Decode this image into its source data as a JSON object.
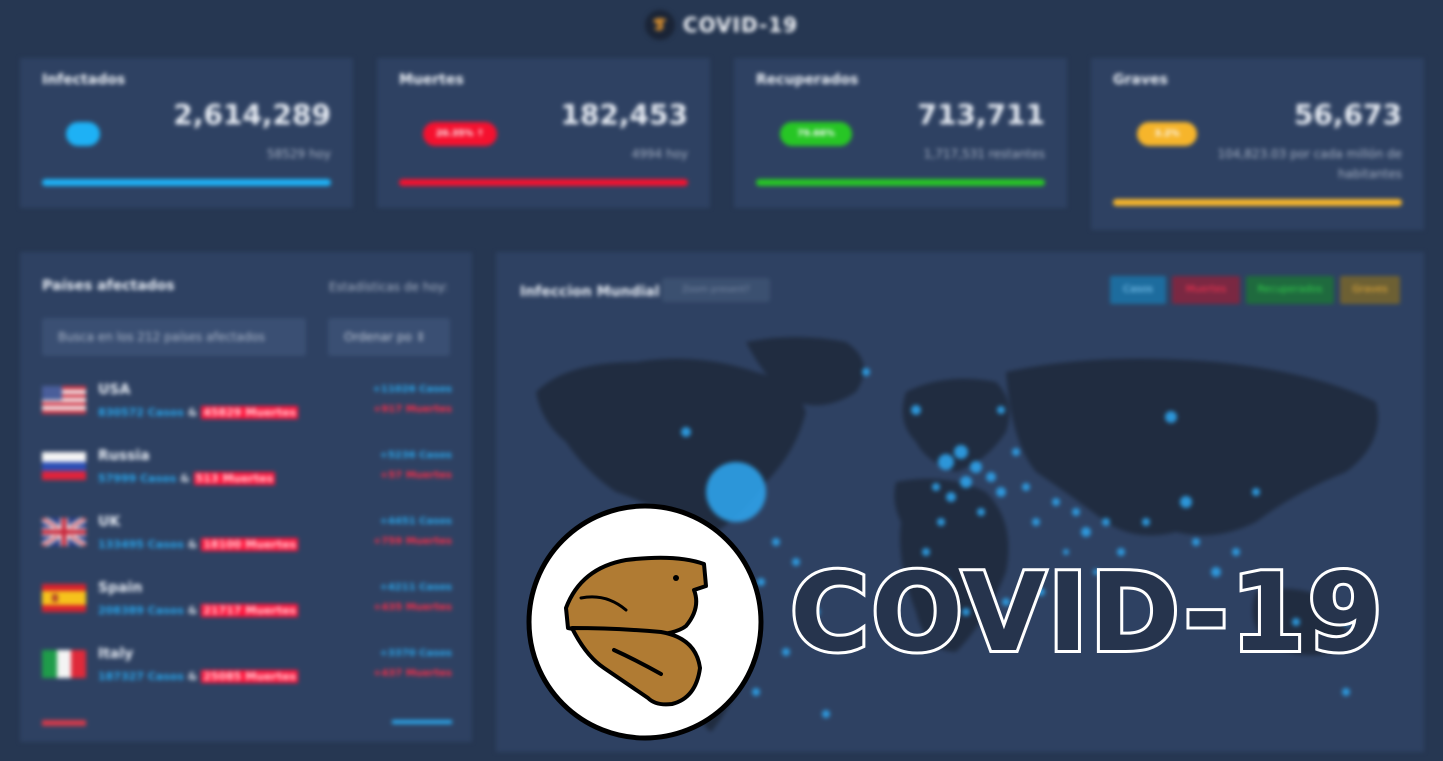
{
  "header": {
    "title": "COVID-19",
    "logo_icon": "bird-logo-icon"
  },
  "cards": [
    {
      "label": "Infectados",
      "value": "2,614,289",
      "sub": "58529 hoy",
      "pill": "",
      "color": "#1eb1f5"
    },
    {
      "label": "Muertes",
      "value": "182,453",
      "sub": "4994 hoy",
      "pill": "20.35% ↑",
      "color": "#f5112f"
    },
    {
      "label": "Recuperados",
      "value": "713,711",
      "sub": "1,717,531 restantes",
      "pill": "79.66%",
      "color": "#27c625"
    },
    {
      "label": "Graves",
      "value": "56,673",
      "sub": "104,823.03 por cada millón de habitantes",
      "pill": "3.2%",
      "color": "#f6b52b"
    }
  ],
  "countries_panel": {
    "title": "Países afectados",
    "subtitle": "Estadísticas de hoy:",
    "search_placeholder": "Busca en los 212 países afectados",
    "sort_label": "Ordenar po ⇕",
    "countries": [
      {
        "name": "USA",
        "cases": "830572 Casos",
        "deaths": "45829 Muertes",
        "today_cases": "+11026 Casos",
        "today_deaths": "+917 Muertes",
        "flag": "us-flag"
      },
      {
        "name": "Russia",
        "cases": "57999 Casos",
        "deaths": "513 Muertes",
        "today_cases": "+5236 Casos",
        "today_deaths": "+57 Muertes",
        "flag": "ru-flag"
      },
      {
        "name": "UK",
        "cases": "133495 Casos",
        "deaths": "18100 Muertes",
        "today_cases": "+4451 Casos",
        "today_deaths": "+759 Muertes",
        "flag": "uk-flag"
      },
      {
        "name": "Spain",
        "cases": "208389 Casos",
        "deaths": "21717 Muertes",
        "today_cases": "+4211 Casos",
        "today_deaths": "+435 Muertes",
        "flag": "es-flag"
      },
      {
        "name": "Italy",
        "cases": "187327 Casos",
        "deaths": "25085 Muertes",
        "today_cases": "+3370 Casos",
        "today_deaths": "+437 Muertes",
        "flag": "it-flag"
      }
    ]
  },
  "map_panel": {
    "title": "Infeccion Mundial",
    "zoom_label": "Zoom present?",
    "filters": [
      {
        "label": "Casos",
        "bg": "#1d6c9e",
        "fg": "#8fd6ff"
      },
      {
        "label": "Muertes",
        "bg": "#7a2842",
        "fg": "#ff3350"
      },
      {
        "label": "Recuperados",
        "bg": "#1f6a3e",
        "fg": "#32d04a"
      },
      {
        "label": "Graves",
        "bg": "#6d6033",
        "fg": "#f2b23a"
      }
    ]
  },
  "overlay": {
    "text": "COVID-19",
    "logo_icon": "bird-logo-icon"
  }
}
